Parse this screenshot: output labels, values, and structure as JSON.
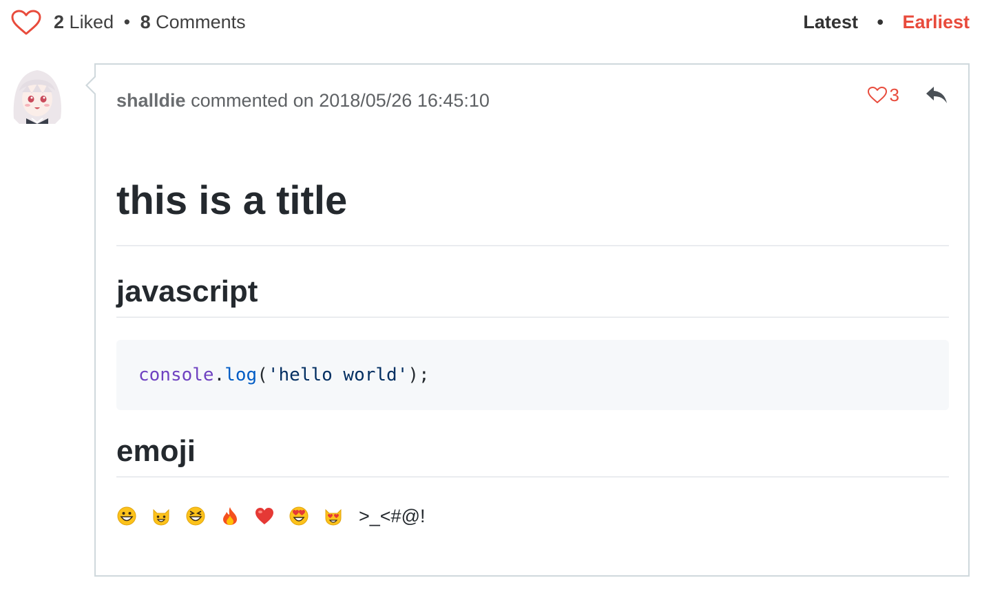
{
  "header": {
    "liked_count": "2",
    "liked_label": "Liked",
    "separator": "•",
    "comments_count": "8",
    "comments_label": "Comments",
    "sort_latest": "Latest",
    "sort_earliest": "Earliest",
    "sort_active": "Earliest"
  },
  "comment": {
    "author": "shalldie",
    "commented_on": "commented on",
    "timestamp": "2018/05/26 16:45:10",
    "like_count": "3",
    "body": {
      "title": "this is a title",
      "heading_js": "javascript",
      "code": {
        "obj": "console",
        "dot": ".",
        "fn": "log",
        "open": "(",
        "str": "'hello world'",
        "close": ");"
      },
      "heading_emoji": "emoji",
      "emoji_icons": [
        "grinning-face-icon",
        "smiley-cat-icon",
        "laughing-face-icon",
        "fire-icon",
        "red-heart-icon",
        "heart-eyes-face-icon",
        "heart-eyes-cat-icon"
      ],
      "emoji_text": ">_<#@!"
    }
  },
  "colors": {
    "accent_red": "#e84b3c",
    "border": "#cfd8dc",
    "code_bg": "#f6f8fa"
  }
}
